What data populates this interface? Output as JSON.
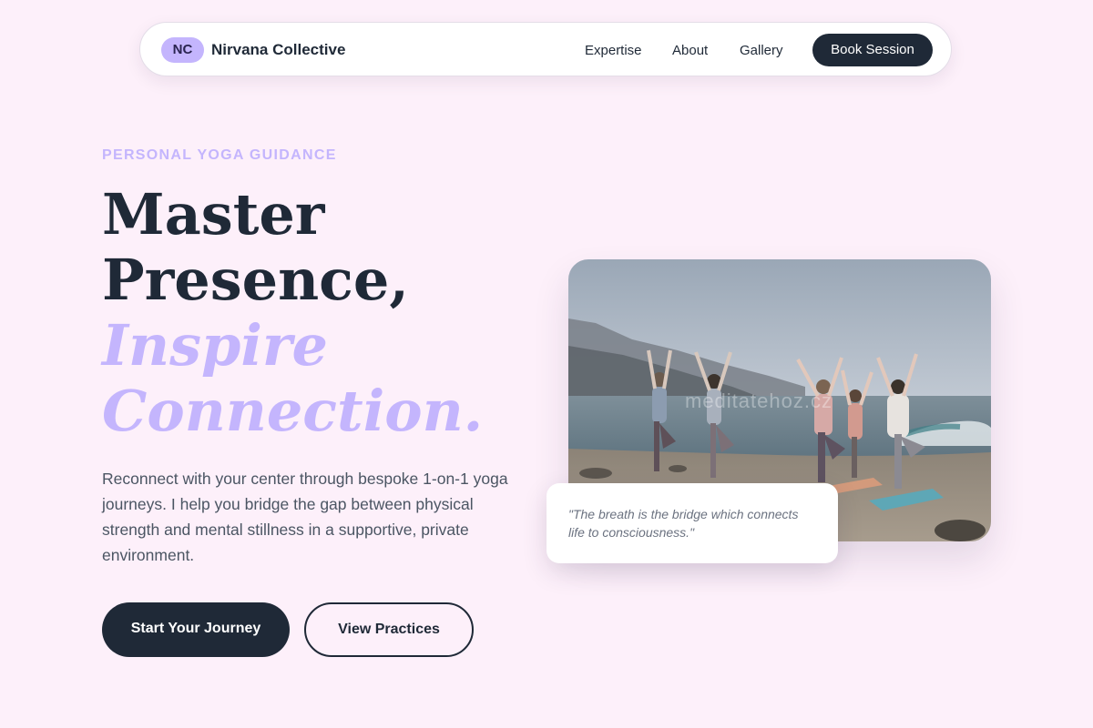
{
  "nav": {
    "badge": "NC",
    "brand": "Nirvana Collective",
    "links": [
      "Expertise",
      "About",
      "Gallery"
    ],
    "cta": "Book Session"
  },
  "hero": {
    "eyebrow": "PERSONAL YOGA GUIDANCE",
    "headline_dark": [
      "Master",
      "Presence,"
    ],
    "headline_accent": [
      "Inspire",
      "Connection."
    ],
    "description": "Reconnect with your center through bespoke 1-on-1 yoga journeys. I help you bridge the gap between physical strength and mental stillness in a supportive, private environment.",
    "primary_cta": "Start Your Journey",
    "secondary_cta": "View Practices"
  },
  "image": {
    "watermark": "meditatehoz.cz",
    "quote": "\"The breath is the bridge which connects life to consciousness.\""
  },
  "colors": {
    "background": "#fdf0fa",
    "accent": "#c4b5fd",
    "dark": "#1f2937"
  }
}
